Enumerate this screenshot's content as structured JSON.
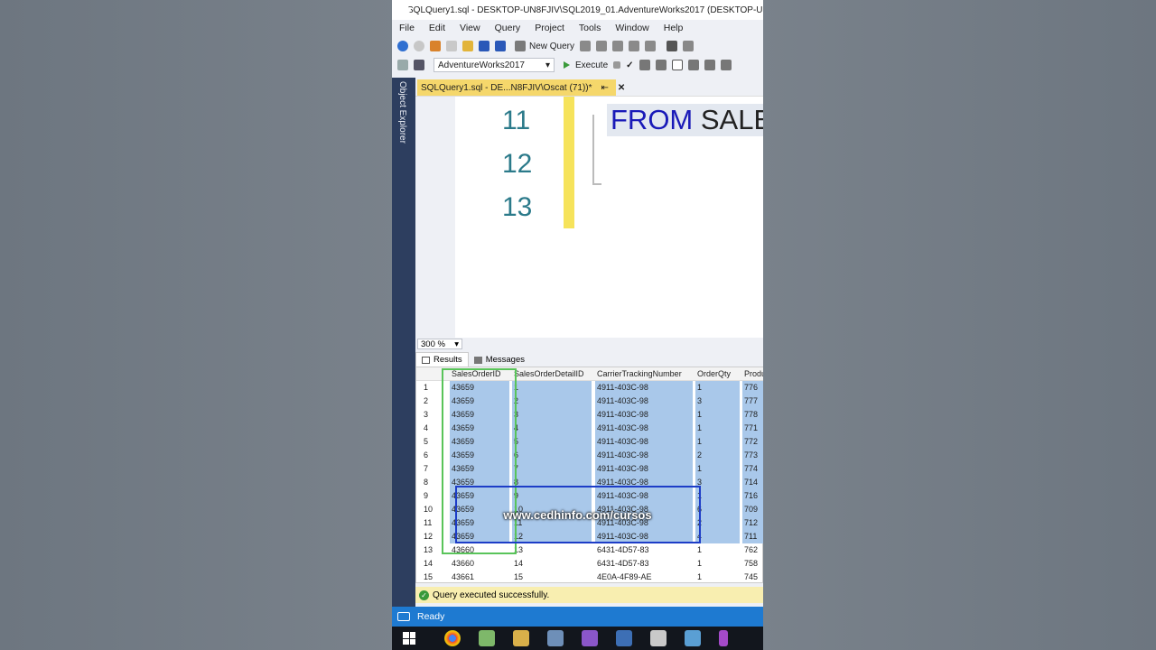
{
  "window": {
    "title": "SQLQuery1.sql - DESKTOP-UN8FJIV\\SQL2019_01.AdventureWorks2017 (DESKTOP-UN"
  },
  "menu": [
    "File",
    "Edit",
    "View",
    "Query",
    "Project",
    "Tools",
    "Window",
    "Help"
  ],
  "toolbar": {
    "new_query": "New Query",
    "database": "AdventureWorks2017",
    "execute": "Execute"
  },
  "sidebar": {
    "label": "Object Explorer"
  },
  "tab": {
    "label": "SQLQuery1.sql - DE...N8FJIV\\Oscat (71))*",
    "pin": "⇤",
    "close": "✕"
  },
  "editor": {
    "line_numbers": [
      "11",
      "12",
      "13"
    ],
    "code_keyword": "FROM",
    "code_rest": " SALES.S"
  },
  "zoom": "300 %",
  "results_tabs": {
    "results": "Results",
    "messages": "Messages"
  },
  "grid": {
    "columns": [
      "SalesOrderID",
      "SalesOrderDetailID",
      "CarrierTrackingNumber",
      "OrderQty",
      "Produ"
    ],
    "rows": [
      [
        "1",
        "43659",
        "1",
        "4911-403C-98",
        "1",
        "776"
      ],
      [
        "2",
        "43659",
        "2",
        "4911-403C-98",
        "3",
        "777"
      ],
      [
        "3",
        "43659",
        "3",
        "4911-403C-98",
        "1",
        "778"
      ],
      [
        "4",
        "43659",
        "4",
        "4911-403C-98",
        "1",
        "771"
      ],
      [
        "5",
        "43659",
        "5",
        "4911-403C-98",
        "1",
        "772"
      ],
      [
        "6",
        "43659",
        "6",
        "4911-403C-98",
        "2",
        "773"
      ],
      [
        "7",
        "43659",
        "7",
        "4911-403C-98",
        "1",
        "774"
      ],
      [
        "8",
        "43659",
        "8",
        "4911-403C-98",
        "3",
        "714"
      ],
      [
        "9",
        "43659",
        "9",
        "4911-403C-98",
        "1",
        "716"
      ],
      [
        "10",
        "43659",
        "10",
        "4911-403C-98",
        "6",
        "709"
      ],
      [
        "11",
        "43659",
        "11",
        "4911-403C-98",
        "2",
        "712"
      ],
      [
        "12",
        "43659",
        "12",
        "4911-403C-98",
        "4",
        "711"
      ],
      [
        "13",
        "43660",
        "13",
        "6431-4D57-83",
        "1",
        "762"
      ],
      [
        "14",
        "43660",
        "14",
        "6431-4D57-83",
        "1",
        "758"
      ],
      [
        "15",
        "43661",
        "15",
        "4E0A-4F89-AE",
        "1",
        "745"
      ]
    ]
  },
  "watermark": "www.cedhinfo.com/cursos",
  "status": {
    "message": "Query executed successfully.",
    "ready": "Ready"
  },
  "colors": {
    "accent": "#1e7ad1",
    "tab": "#f5d76b",
    "keyword": "#1a1ab8",
    "selection": "#a9c8ea"
  }
}
